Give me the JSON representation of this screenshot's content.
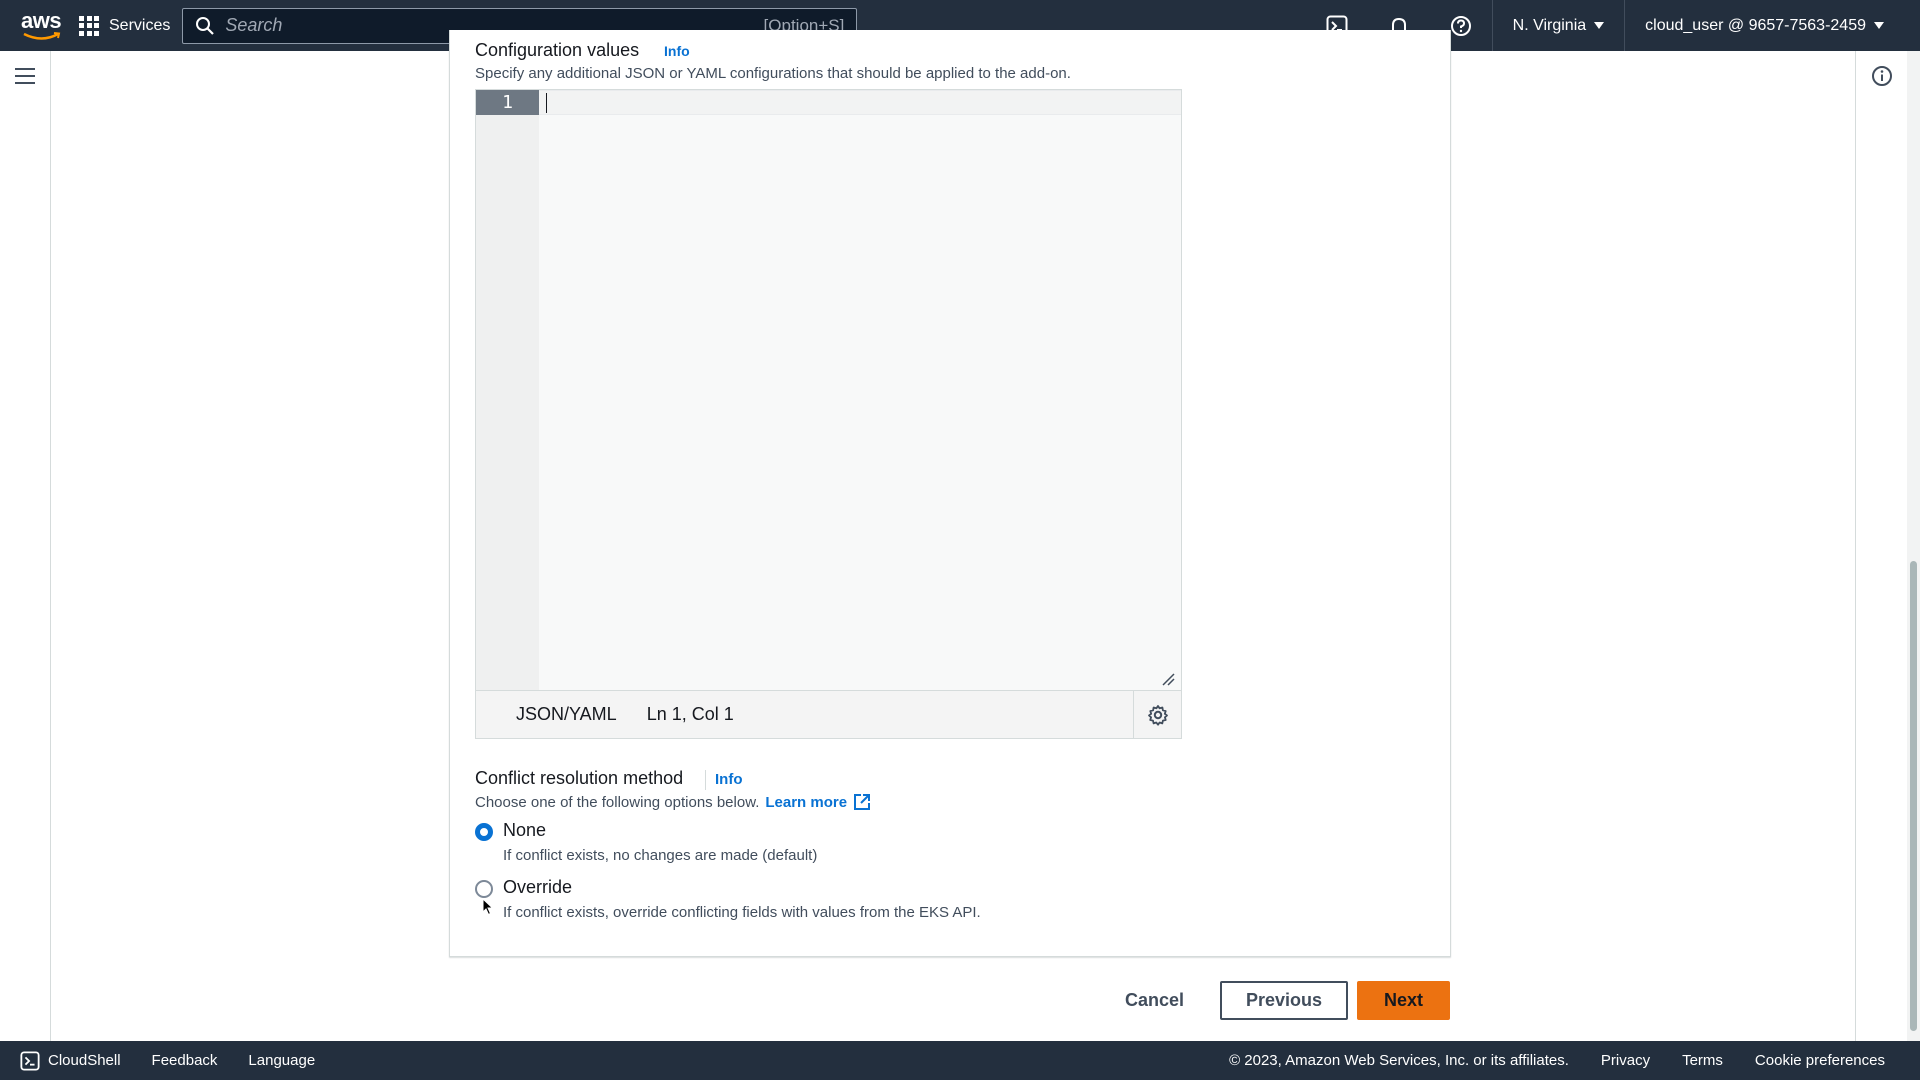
{
  "topnav": {
    "logo_text": "aws",
    "services_label": "Services",
    "search_placeholder": "Search",
    "search_shortcut": "[Option+S]",
    "region": "N. Virginia",
    "account": "cloud_user @ 9657-7563-2459",
    "icons": [
      "cloudshell-icon",
      "bell-icon",
      "help-icon"
    ]
  },
  "config": {
    "title": "Configuration values",
    "info": "Info",
    "description": "Specify any additional JSON or YAML configurations that should be applied to the add-on.",
    "editor": {
      "line_number": "1",
      "language": "JSON/YAML",
      "position": "Ln 1, Col 1"
    }
  },
  "conflict": {
    "title": "Conflict resolution method",
    "info": "Info",
    "description": "Choose one of the following options below.",
    "learn_more": "Learn more",
    "options": [
      {
        "label": "None",
        "description": "If conflict exists, no changes are made (default)",
        "selected": true
      },
      {
        "label": "Override",
        "description": "If conflict exists, override conflicting fields with values from the EKS API.",
        "selected": false
      }
    ]
  },
  "actions": {
    "cancel": "Cancel",
    "previous": "Previous",
    "next": "Next"
  },
  "footer": {
    "cloudshell": "CloudShell",
    "feedback": "Feedback",
    "language": "Language",
    "copyright": "© 2023, Amazon Web Services, Inc. or its affiliates.",
    "privacy": "Privacy",
    "terms": "Terms",
    "cookies": "Cookie preferences"
  },
  "colors": {
    "nav_bg": "#232f3e",
    "link": "#0972d3",
    "primary_button": "#ec7211"
  }
}
